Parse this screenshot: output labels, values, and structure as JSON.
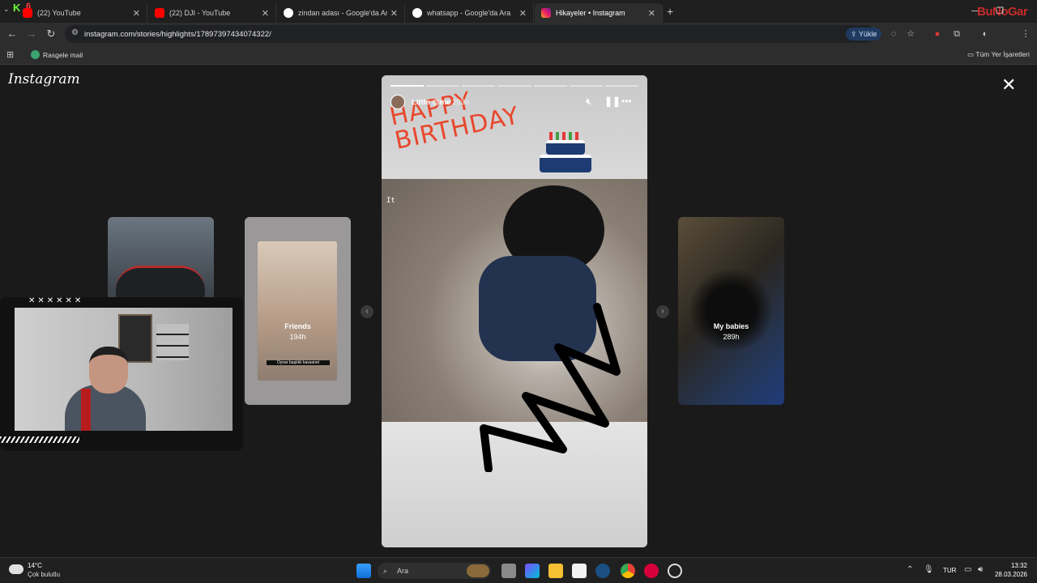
{
  "browser": {
    "tabs": [
      {
        "title": "(22) YouTube",
        "favicon": "youtube-icon"
      },
      {
        "title": "(22) DJI - YouTube",
        "favicon": "youtube-icon"
      },
      {
        "title": "zindan adası - Google'da Ara",
        "favicon": "google-icon"
      },
      {
        "title": "whatsapp - Google'da Ara",
        "favicon": "google-icon"
      },
      {
        "title": "Hikayeler • Instagram",
        "favicon": "instagram-icon",
        "active": true
      }
    ],
    "new_tab": "+",
    "url": "instagram.com/stories/highlights/17897397434074322/",
    "yukle_label": "Yükle",
    "bookmarks": {
      "item": "Rasgele mail",
      "all_bookmarks": "Tüm Yer İşaretleri"
    },
    "brand_badge": "K",
    "brand_badge_num": "6"
  },
  "instagram": {
    "logo": "Instagram",
    "close": "✕",
    "story": {
      "user": "Little @me",
      "time": "293h",
      "progress_segments": 7,
      "current_segment_progress": 1.0,
      "sticker_text": "HAPPY BIRTHDAY",
      "small_text": "It"
    },
    "highlights": [
      {
        "name": "Friends",
        "time": "194h",
        "caption": "Oynar başlıklı kavsanet"
      },
      {
        "name": "My babies",
        "time": "289h"
      }
    ],
    "overlay_marks": "✕✕✕✕✕✕"
  },
  "taskbar": {
    "weather_temp": "14°C",
    "weather_desc": "Çok bulutlu",
    "search_placeholder": "Ara",
    "lang": "TUR",
    "time": "13:32",
    "date": "28.03.2026"
  },
  "watermark": "BuNoGar",
  "colors": {
    "accent_red": "#e8472d",
    "youtube_red": "#ff0000",
    "chrome_dark": "#202124"
  }
}
